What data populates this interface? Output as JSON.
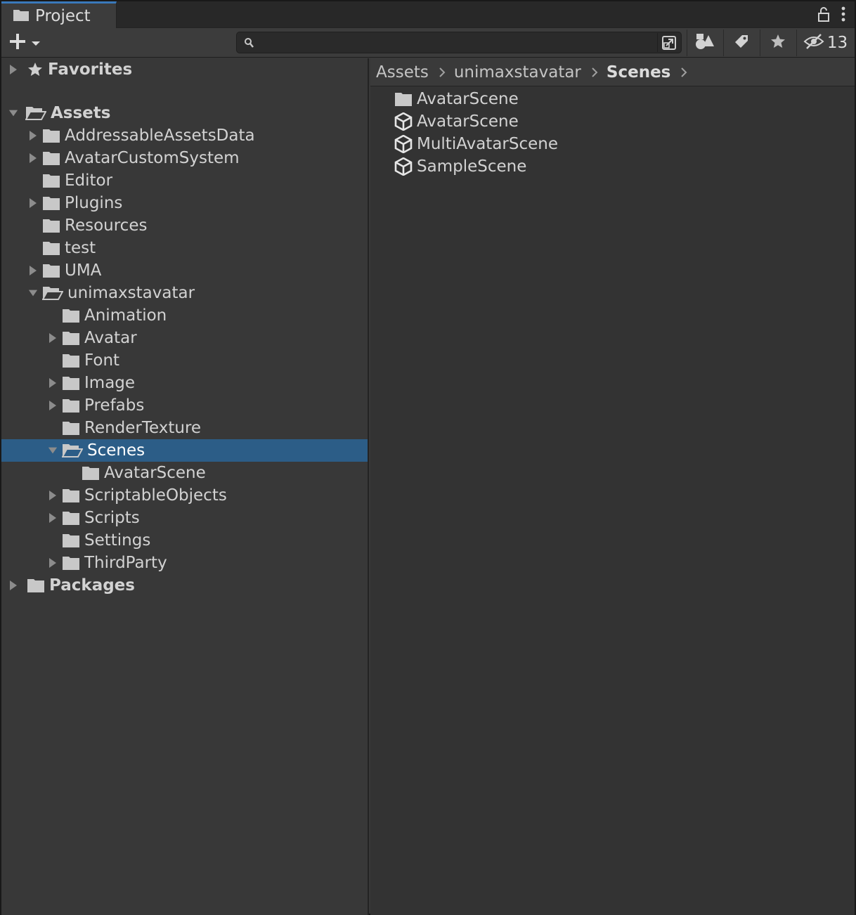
{
  "window": {
    "tab_label": "Project"
  },
  "toolbar": {
    "search_value": "",
    "hidden_count": "13"
  },
  "favorites": {
    "label": "Favorites"
  },
  "tree": {
    "assets": "Assets",
    "items": [
      {
        "label": "AddressableAssetsData",
        "has_children": true
      },
      {
        "label": "AvatarCustomSystem",
        "has_children": true
      },
      {
        "label": "Editor",
        "has_children": false
      },
      {
        "label": "Plugins",
        "has_children": true
      },
      {
        "label": "Resources",
        "has_children": false
      },
      {
        "label": "test",
        "has_children": false
      },
      {
        "label": "UMA",
        "has_children": true
      },
      {
        "label": "unimaxstavatar",
        "expanded": true
      },
      {
        "label": "Animation",
        "has_children": false
      },
      {
        "label": "Avatar",
        "has_children": true
      },
      {
        "label": "Font",
        "has_children": false
      },
      {
        "label": "Image",
        "has_children": true
      },
      {
        "label": "Prefabs",
        "has_children": true
      },
      {
        "label": "RenderTexture",
        "has_children": false
      },
      {
        "label": "Scenes",
        "expanded": true,
        "selected": true
      },
      {
        "label": "AvatarScene",
        "has_children": false
      },
      {
        "label": "ScriptableObjects",
        "has_children": true
      },
      {
        "label": "Scripts",
        "has_children": true
      },
      {
        "label": "Settings",
        "has_children": false
      },
      {
        "label": "ThirdParty",
        "has_children": true
      }
    ],
    "packages": "Packages"
  },
  "breadcrumb": [
    "Assets",
    "unimaxstavatar",
    "Scenes"
  ],
  "contents": [
    {
      "label": "AvatarScene",
      "icon": "folder-icon"
    },
    {
      "label": "AvatarScene",
      "icon": "unity-scene-icon"
    },
    {
      "label": "MultiAvatarScene",
      "icon": "unity-scene-icon"
    },
    {
      "label": "SampleScene",
      "icon": "unity-scene-icon"
    }
  ],
  "colors": {
    "selection": "#2c5d87",
    "tab_accent": "#3a79bb",
    "panel_bg": "#383838"
  }
}
